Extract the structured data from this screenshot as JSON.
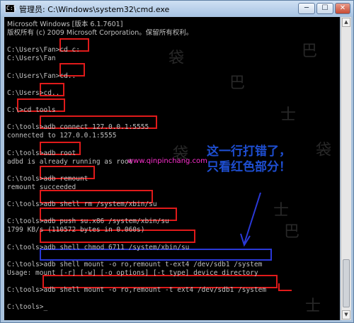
{
  "window": {
    "title": "管理员: C:\\Windows\\system32\\cmd.exe",
    "app_icon_text": "C:\\",
    "min_symbol": "─",
    "max_symbol": "☐",
    "close_symbol": "✕"
  },
  "console": {
    "lines": [
      "Microsoft Windows [版本 6.1.7601]",
      "版权所有 (c) 2009 Microsoft Corporation。保留所有权利。",
      "",
      "C:\\Users\\Fan>cd c:",
      "C:\\Users\\Fan",
      "",
      "C:\\Users\\Fan>cd..",
      "",
      "C:\\Users>cd..",
      "",
      "C:\\>cd tools",
      "",
      "C:\\tools>adb connect 127.0.0.1:5555",
      "connected to 127.0.0.1:5555",
      "",
      "C:\\tools>adb root",
      "adbd is already running as root",
      "",
      "C:\\tools>adb remount",
      "remount succeeded",
      "",
      "C:\\tools>adb shell rm /system/xbin/su",
      "",
      "C:\\tools>adb push su.x86 /system/xbin/su",
      "1799 KB/s (110572 bytes in 0.060s)",
      "",
      "C:\\tools>adb shell chmod 6711 /system/xbin/su",
      "",
      "C:\\tools>adb shell mount -o ro,remount t-ext4 /dev/sdb1 /system",
      "Usage: mount [-r] [-w] [-o options] [-t type] device directory",
      "",
      "C:\\tools>adb shell mount -o ro,remount -t ext4 /dev/sdb1 /system",
      "",
      "C:\\tools>_"
    ]
  },
  "annotation": {
    "line1": "这一行打错了，",
    "line2": "只看红色部分！"
  },
  "watermark": {
    "url": "www.qinpinchang.com",
    "glyphs": [
      "袋",
      "巴",
      "士",
      "袋",
      "巴",
      "士",
      "袋",
      "巴",
      "士"
    ]
  },
  "colors": {
    "console_bg": "#000000",
    "console_text": "#c0c0c0",
    "highlight_red": "#e01a1a",
    "highlight_blue": "#2a39d8",
    "annotation_blue": "#1e4ed0",
    "watermark_pink": "#ff30d0"
  }
}
